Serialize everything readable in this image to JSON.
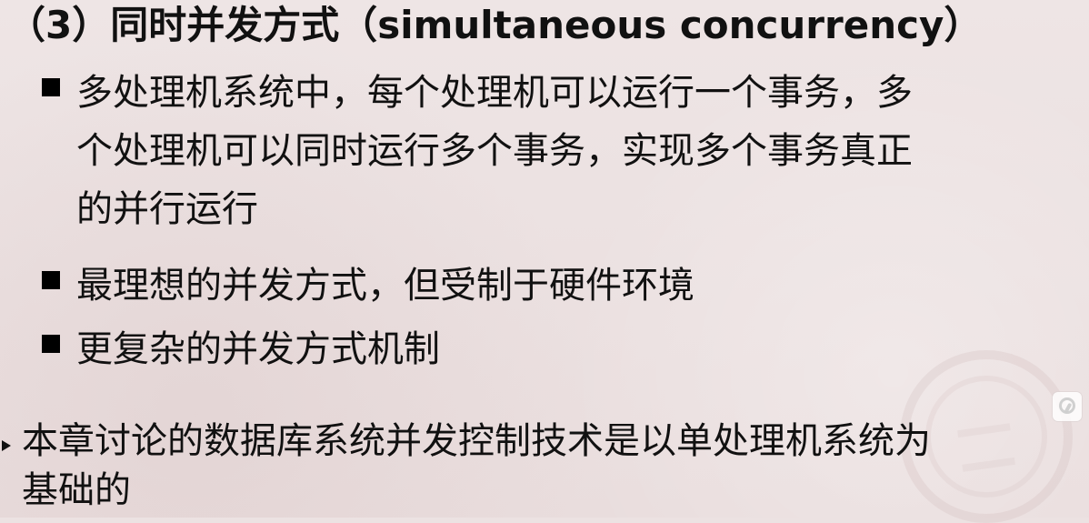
{
  "slide": {
    "heading": "（3）同时并发方式（simultaneous  concurrency）",
    "bullets": [
      {
        "lines": [
          "多处理机系统中，每个处理机可以运行一个事务，多",
          "个处理机可以同时运行多个事务，实现多个事务真正",
          "的并行运行"
        ]
      },
      {
        "lines": [
          "最理想的并发方式，但受制于硬件环境"
        ]
      },
      {
        "lines": [
          "更复杂的并发方式机制"
        ]
      }
    ],
    "footer_point": {
      "lines": [
        "本章讨论的数据库系统并发控制技术是以单处理机系统为",
        "基础的"
      ]
    }
  },
  "icons": {
    "bullet": "square-bullet-icon",
    "subpoint": "triangle-bullet-icon",
    "watermark": "university-seal-icon",
    "corner": "app-overlay-icon"
  },
  "colors": {
    "background": "#ece2e2",
    "text": "#111111",
    "bullet": "#000000"
  }
}
